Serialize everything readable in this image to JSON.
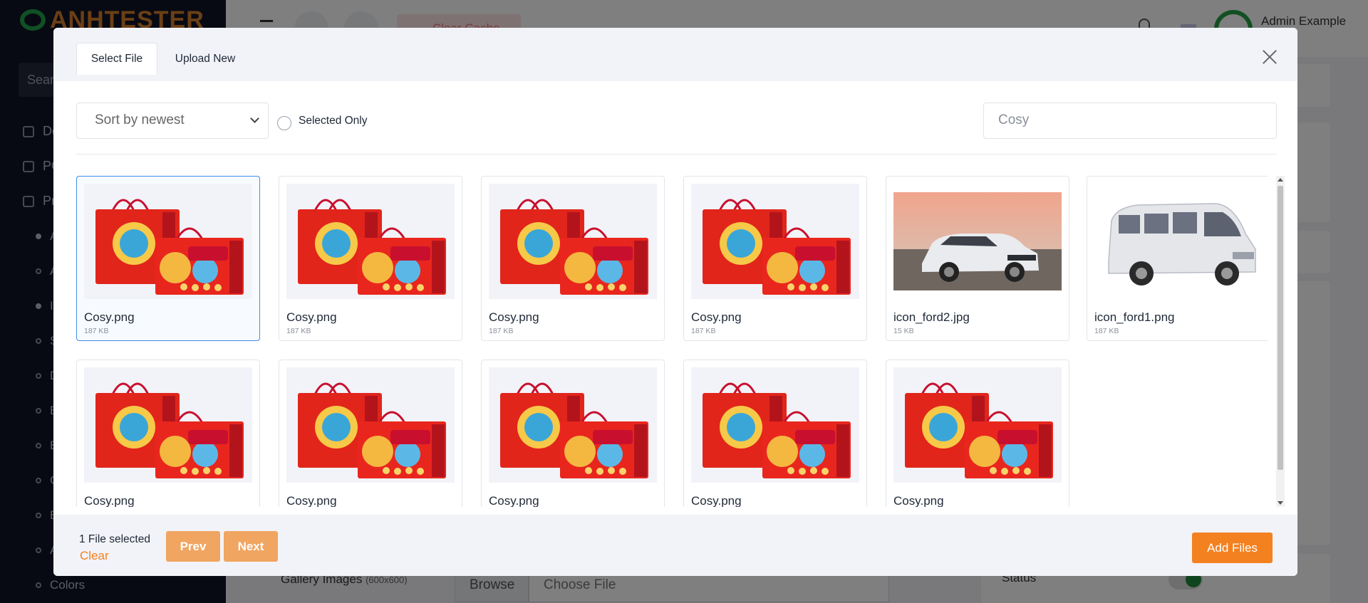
{
  "background": {
    "logo_text": "ANHTESTER",
    "search_placeholder": "Sear",
    "nav_items": [
      {
        "label": "Do",
        "type": "main"
      },
      {
        "label": "PO",
        "type": "main"
      },
      {
        "label": "Pro",
        "type": "main"
      },
      {
        "label": "A",
        "type": "sub-filled"
      },
      {
        "label": "A",
        "type": "sub"
      },
      {
        "label": "In",
        "type": "sub-filled"
      },
      {
        "label": "S",
        "type": "sub"
      },
      {
        "label": "D",
        "type": "sub"
      },
      {
        "label": "B",
        "type": "sub"
      },
      {
        "label": "B",
        "type": "sub"
      },
      {
        "label": "C",
        "type": "sub"
      },
      {
        "label": "B",
        "type": "sub"
      },
      {
        "label": "A",
        "type": "sub"
      },
      {
        "label": "Colors",
        "type": "sub"
      }
    ],
    "clear_cache_label": "Clear Cache",
    "admin_name": "Admin Example",
    "gallery_label": "Gallery Images",
    "gallery_size": "(600x600)",
    "browse_label": "Browse",
    "choose_file_label": "Choose File",
    "status_label": "Status"
  },
  "modal": {
    "tabs": [
      {
        "label": "Select File",
        "active": true
      },
      {
        "label": "Upload New",
        "active": false
      }
    ],
    "sort_select": {
      "value": "Sort by newest"
    },
    "selected_only_label": "Selected Only",
    "search": {
      "value": "Cosy"
    },
    "files": [
      {
        "name": "Cosy.png",
        "size": "187 KB",
        "image": "cosy-gift-box",
        "selected": true
      },
      {
        "name": "Cosy.png",
        "size": "187 KB",
        "image": "cosy-gift-box",
        "selected": false
      },
      {
        "name": "Cosy.png",
        "size": "187 KB",
        "image": "cosy-gift-box",
        "selected": false
      },
      {
        "name": "Cosy.png",
        "size": "187 KB",
        "image": "cosy-gift-box",
        "selected": false
      },
      {
        "name": "icon_ford2.jpg",
        "size": "15 KB",
        "image": "white-suv-photo",
        "selected": false
      },
      {
        "name": "icon_ford1.png",
        "size": "187 KB",
        "image": "white-van",
        "selected": false
      },
      {
        "name": "Cosy.png",
        "size": "",
        "image": "cosy-gift-box",
        "selected": false
      },
      {
        "name": "Cosy.png",
        "size": "",
        "image": "cosy-gift-box",
        "selected": false
      },
      {
        "name": "Cosy.png",
        "size": "",
        "image": "cosy-gift-box",
        "selected": false
      },
      {
        "name": "Cosy.png",
        "size": "",
        "image": "cosy-gift-box",
        "selected": false
      },
      {
        "name": "Cosy.png",
        "size": "",
        "image": "cosy-gift-box",
        "selected": false
      }
    ],
    "footer": {
      "selected_count": "1 File selected",
      "clear_label": "Clear",
      "prev_label": "Prev",
      "next_label": "Next",
      "add_files_label": "Add Files"
    }
  },
  "colors": {
    "accent_orange": "#f48120",
    "nav_button_orange": "#f0a561",
    "selected_border": "#3d8ee8",
    "sidebar_bg": "#111427"
  }
}
